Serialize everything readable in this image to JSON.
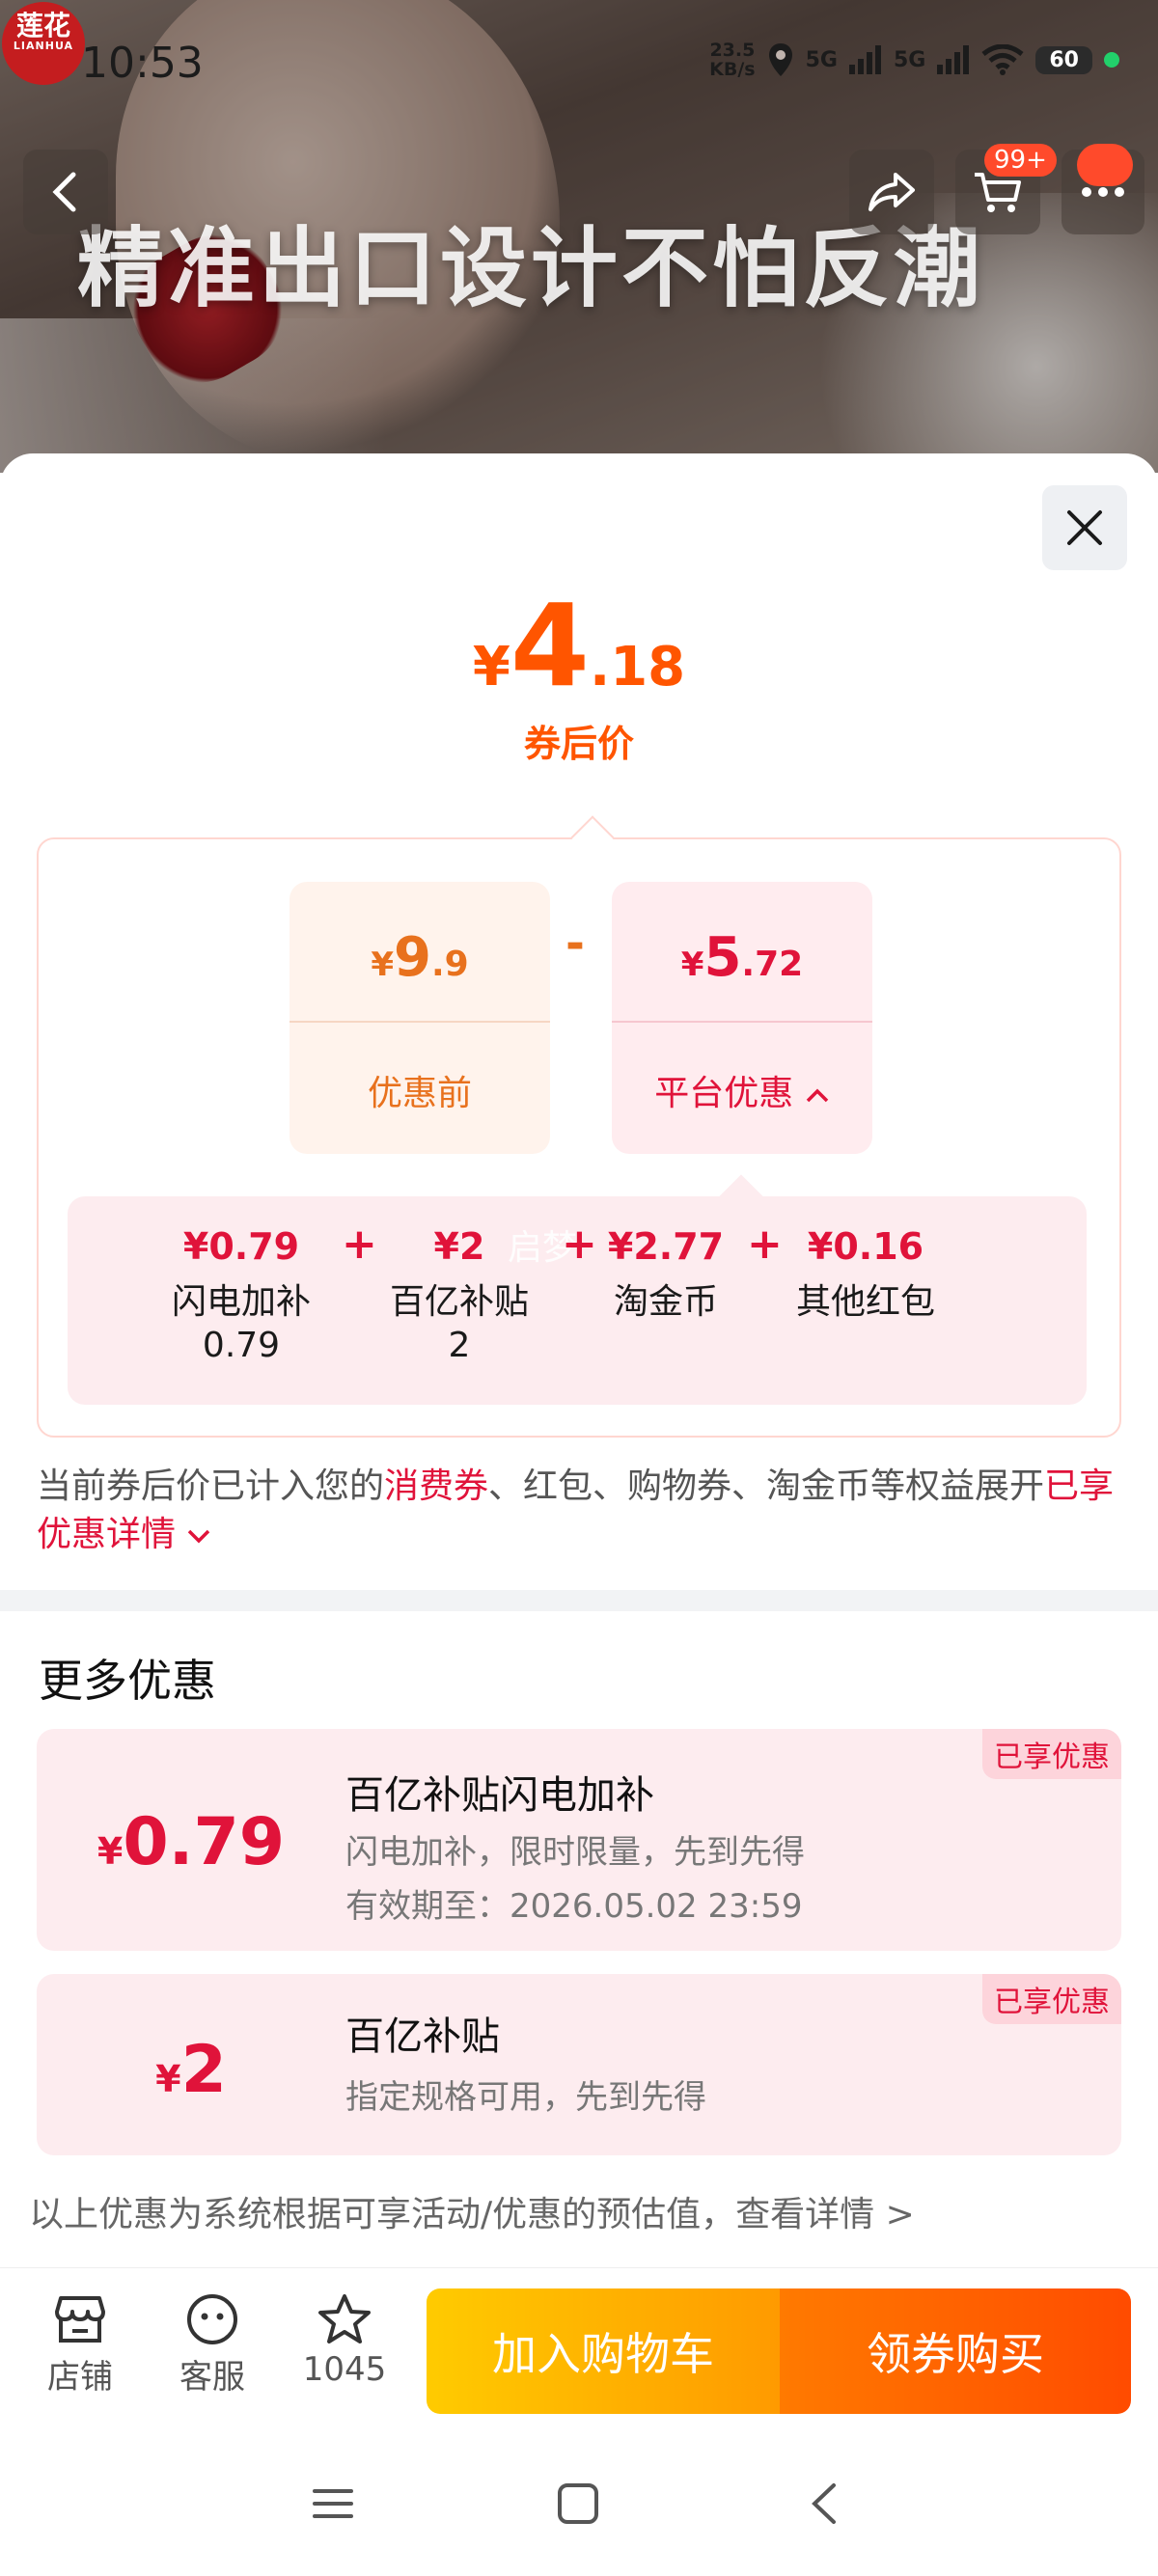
{
  "status_bar": {
    "time": "10:53",
    "speed_value": "23.5",
    "speed_unit": "KB/s",
    "signal1": "5G",
    "signal2": "5G",
    "battery": "60"
  },
  "brand_logo": {
    "line1": "莲花",
    "line2": "LIANHUA"
  },
  "banner": {
    "caption": "精准出口设计不怕反潮"
  },
  "header_nav": {
    "cart_badge": "99+"
  },
  "price": {
    "symbol": "¥",
    "integer": "4",
    "decimal": ".18",
    "label": "券后价"
  },
  "breakdown": {
    "original": {
      "symbol": "¥",
      "integer": "9",
      "decimal": ".9",
      "label": "优惠前"
    },
    "operator": "-",
    "platform": {
      "symbol": "¥",
      "integer": "5",
      "decimal": ".72",
      "label": "平台优惠"
    },
    "sub_items": [
      {
        "amount": "¥0.79",
        "name": "闪电加补",
        "subvalue": "0.79"
      },
      {
        "amount": "¥2",
        "name": "百亿补贴",
        "subvalue": "2"
      },
      {
        "amount": "¥2.77",
        "name": "淘金币",
        "subvalue": ""
      },
      {
        "amount": "¥0.16",
        "name": "其他红包",
        "subvalue": ""
      }
    ],
    "plus": "+",
    "watermark": "启梦"
  },
  "note": {
    "part1": "当前券后价已计入您的",
    "highlight": "消费券",
    "part2": "、红包、购物券、淘金币等权益展开",
    "link": "已享优惠详情"
  },
  "more": {
    "title": "更多优惠",
    "coupons": [
      {
        "symbol": "¥",
        "value": "0.79",
        "title": "百亿补贴闪电加补",
        "desc": "闪电加补，限时限量，先到先得",
        "expiry": "有效期至：2026.05.02 23:59",
        "tag": "已享优惠"
      },
      {
        "symbol": "¥",
        "value": "2",
        "title": "百亿补贴",
        "desc": "指定规格可用，先到先得",
        "tag": "已享优惠"
      }
    ],
    "disclaimer": "以上优惠为系统根据可享活动/优惠的预估值，查看详情 >"
  },
  "bottom": {
    "store_label": "店铺",
    "service_label": "客服",
    "favorite_count": "1045",
    "add_cart_label": "加入购物车",
    "buy_label": "领券购买"
  },
  "colors": {
    "accent_orange": "#ff5500",
    "accent_red": "#e0133a",
    "cart_button": "#ffb000",
    "buy_button": "#ff6000"
  }
}
